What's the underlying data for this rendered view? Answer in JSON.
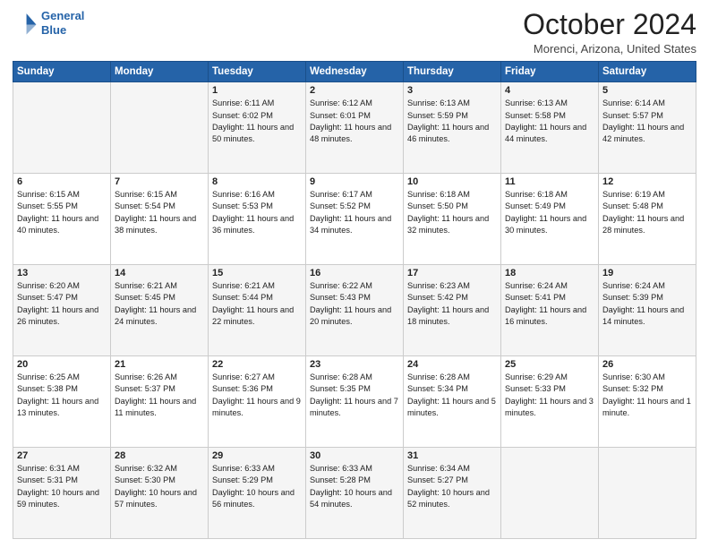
{
  "header": {
    "logo_line1": "General",
    "logo_line2": "Blue",
    "main_title": "October 2024",
    "subtitle": "Morenci, Arizona, United States"
  },
  "days_of_week": [
    "Sunday",
    "Monday",
    "Tuesday",
    "Wednesday",
    "Thursday",
    "Friday",
    "Saturday"
  ],
  "weeks": [
    [
      {
        "day": "",
        "info": ""
      },
      {
        "day": "",
        "info": ""
      },
      {
        "day": "1",
        "info": "Sunrise: 6:11 AM\nSunset: 6:02 PM\nDaylight: 11 hours and 50 minutes."
      },
      {
        "day": "2",
        "info": "Sunrise: 6:12 AM\nSunset: 6:01 PM\nDaylight: 11 hours and 48 minutes."
      },
      {
        "day": "3",
        "info": "Sunrise: 6:13 AM\nSunset: 5:59 PM\nDaylight: 11 hours and 46 minutes."
      },
      {
        "day": "4",
        "info": "Sunrise: 6:13 AM\nSunset: 5:58 PM\nDaylight: 11 hours and 44 minutes."
      },
      {
        "day": "5",
        "info": "Sunrise: 6:14 AM\nSunset: 5:57 PM\nDaylight: 11 hours and 42 minutes."
      }
    ],
    [
      {
        "day": "6",
        "info": "Sunrise: 6:15 AM\nSunset: 5:55 PM\nDaylight: 11 hours and 40 minutes."
      },
      {
        "day": "7",
        "info": "Sunrise: 6:15 AM\nSunset: 5:54 PM\nDaylight: 11 hours and 38 minutes."
      },
      {
        "day": "8",
        "info": "Sunrise: 6:16 AM\nSunset: 5:53 PM\nDaylight: 11 hours and 36 minutes."
      },
      {
        "day": "9",
        "info": "Sunrise: 6:17 AM\nSunset: 5:52 PM\nDaylight: 11 hours and 34 minutes."
      },
      {
        "day": "10",
        "info": "Sunrise: 6:18 AM\nSunset: 5:50 PM\nDaylight: 11 hours and 32 minutes."
      },
      {
        "day": "11",
        "info": "Sunrise: 6:18 AM\nSunset: 5:49 PM\nDaylight: 11 hours and 30 minutes."
      },
      {
        "day": "12",
        "info": "Sunrise: 6:19 AM\nSunset: 5:48 PM\nDaylight: 11 hours and 28 minutes."
      }
    ],
    [
      {
        "day": "13",
        "info": "Sunrise: 6:20 AM\nSunset: 5:47 PM\nDaylight: 11 hours and 26 minutes."
      },
      {
        "day": "14",
        "info": "Sunrise: 6:21 AM\nSunset: 5:45 PM\nDaylight: 11 hours and 24 minutes."
      },
      {
        "day": "15",
        "info": "Sunrise: 6:21 AM\nSunset: 5:44 PM\nDaylight: 11 hours and 22 minutes."
      },
      {
        "day": "16",
        "info": "Sunrise: 6:22 AM\nSunset: 5:43 PM\nDaylight: 11 hours and 20 minutes."
      },
      {
        "day": "17",
        "info": "Sunrise: 6:23 AM\nSunset: 5:42 PM\nDaylight: 11 hours and 18 minutes."
      },
      {
        "day": "18",
        "info": "Sunrise: 6:24 AM\nSunset: 5:41 PM\nDaylight: 11 hours and 16 minutes."
      },
      {
        "day": "19",
        "info": "Sunrise: 6:24 AM\nSunset: 5:39 PM\nDaylight: 11 hours and 14 minutes."
      }
    ],
    [
      {
        "day": "20",
        "info": "Sunrise: 6:25 AM\nSunset: 5:38 PM\nDaylight: 11 hours and 13 minutes."
      },
      {
        "day": "21",
        "info": "Sunrise: 6:26 AM\nSunset: 5:37 PM\nDaylight: 11 hours and 11 minutes."
      },
      {
        "day": "22",
        "info": "Sunrise: 6:27 AM\nSunset: 5:36 PM\nDaylight: 11 hours and 9 minutes."
      },
      {
        "day": "23",
        "info": "Sunrise: 6:28 AM\nSunset: 5:35 PM\nDaylight: 11 hours and 7 minutes."
      },
      {
        "day": "24",
        "info": "Sunrise: 6:28 AM\nSunset: 5:34 PM\nDaylight: 11 hours and 5 minutes."
      },
      {
        "day": "25",
        "info": "Sunrise: 6:29 AM\nSunset: 5:33 PM\nDaylight: 11 hours and 3 minutes."
      },
      {
        "day": "26",
        "info": "Sunrise: 6:30 AM\nSunset: 5:32 PM\nDaylight: 11 hours and 1 minute."
      }
    ],
    [
      {
        "day": "27",
        "info": "Sunrise: 6:31 AM\nSunset: 5:31 PM\nDaylight: 10 hours and 59 minutes."
      },
      {
        "day": "28",
        "info": "Sunrise: 6:32 AM\nSunset: 5:30 PM\nDaylight: 10 hours and 57 minutes."
      },
      {
        "day": "29",
        "info": "Sunrise: 6:33 AM\nSunset: 5:29 PM\nDaylight: 10 hours and 56 minutes."
      },
      {
        "day": "30",
        "info": "Sunrise: 6:33 AM\nSunset: 5:28 PM\nDaylight: 10 hours and 54 minutes."
      },
      {
        "day": "31",
        "info": "Sunrise: 6:34 AM\nSunset: 5:27 PM\nDaylight: 10 hours and 52 minutes."
      },
      {
        "day": "",
        "info": ""
      },
      {
        "day": "",
        "info": ""
      }
    ]
  ]
}
